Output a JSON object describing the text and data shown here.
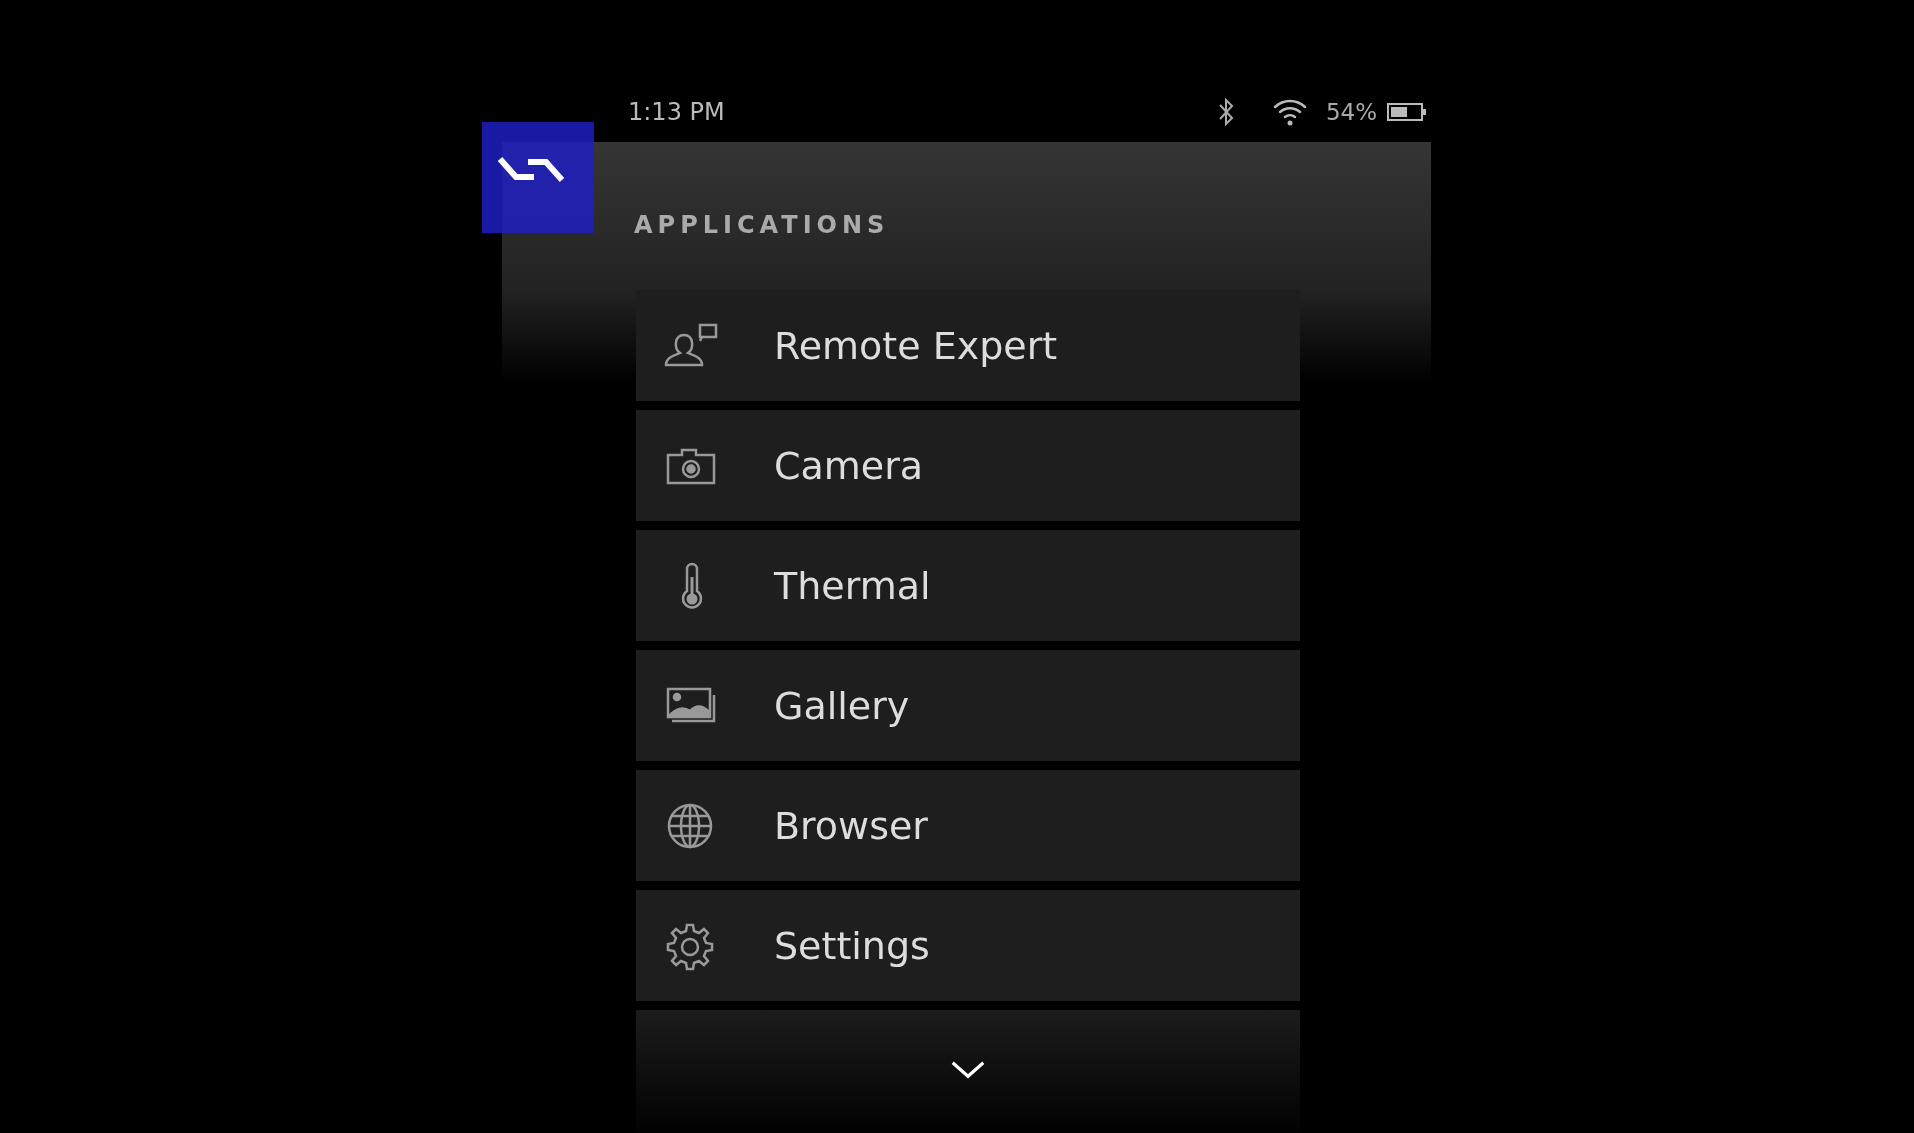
{
  "status_bar": {
    "time": "1:13 PM",
    "battery": "54%"
  },
  "header": {
    "title": "APPLICATIONS"
  },
  "apps": [
    {
      "label": "Remote Expert",
      "kind": "expert"
    },
    {
      "label": "Camera",
      "kind": "camera"
    },
    {
      "label": "Thermal",
      "kind": "thermal"
    },
    {
      "label": "Gallery",
      "kind": "gallery"
    },
    {
      "label": "Browser",
      "kind": "browser"
    },
    {
      "label": "Settings",
      "kind": "settings"
    }
  ]
}
